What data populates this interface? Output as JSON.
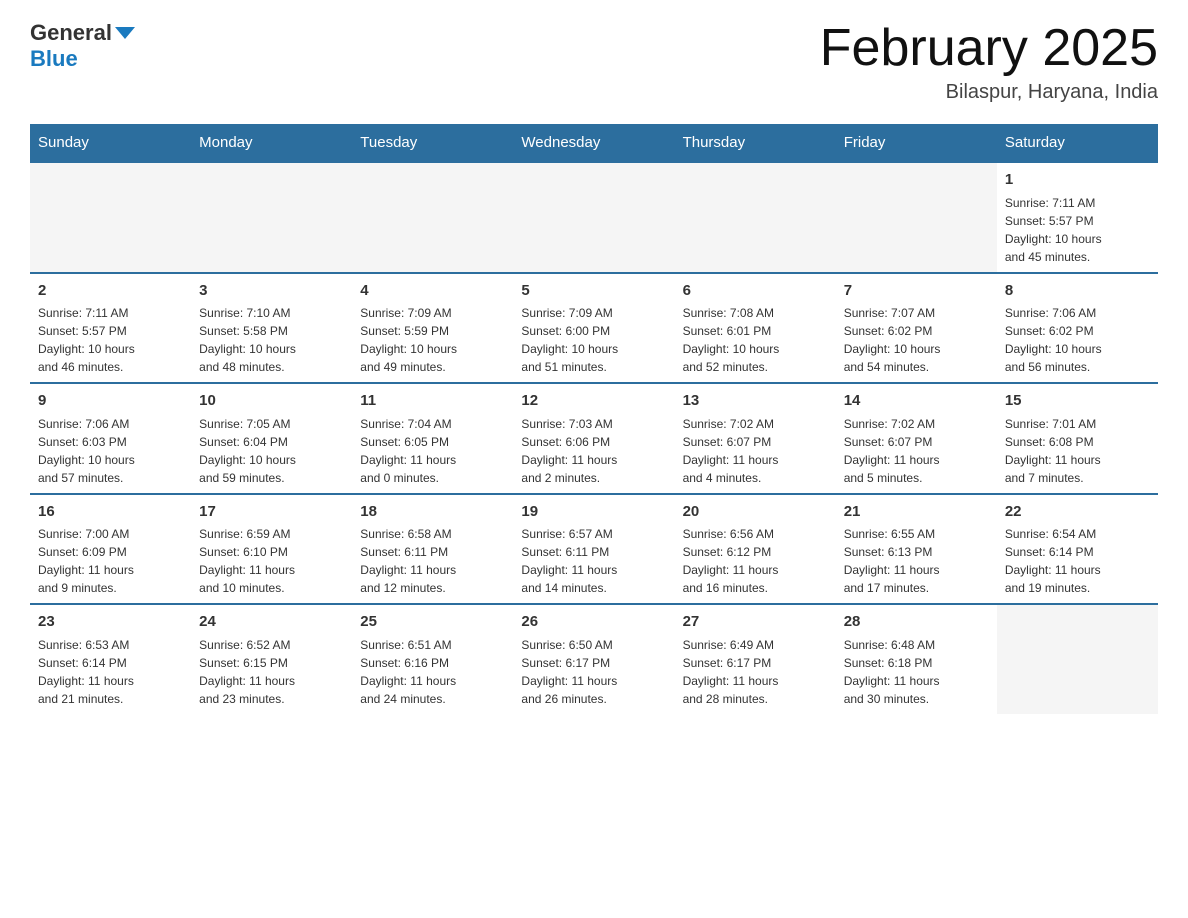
{
  "header": {
    "logo_general": "General",
    "logo_blue": "Blue",
    "title": "February 2025",
    "subtitle": "Bilaspur, Haryana, India"
  },
  "weekdays": [
    "Sunday",
    "Monday",
    "Tuesday",
    "Wednesday",
    "Thursday",
    "Friday",
    "Saturday"
  ],
  "weeks": [
    [
      {
        "day": "",
        "info": ""
      },
      {
        "day": "",
        "info": ""
      },
      {
        "day": "",
        "info": ""
      },
      {
        "day": "",
        "info": ""
      },
      {
        "day": "",
        "info": ""
      },
      {
        "day": "",
        "info": ""
      },
      {
        "day": "1",
        "info": "Sunrise: 7:11 AM\nSunset: 5:57 PM\nDaylight: 10 hours\nand 45 minutes."
      }
    ],
    [
      {
        "day": "2",
        "info": "Sunrise: 7:11 AM\nSunset: 5:57 PM\nDaylight: 10 hours\nand 46 minutes."
      },
      {
        "day": "3",
        "info": "Sunrise: 7:10 AM\nSunset: 5:58 PM\nDaylight: 10 hours\nand 48 minutes."
      },
      {
        "day": "4",
        "info": "Sunrise: 7:09 AM\nSunset: 5:59 PM\nDaylight: 10 hours\nand 49 minutes."
      },
      {
        "day": "5",
        "info": "Sunrise: 7:09 AM\nSunset: 6:00 PM\nDaylight: 10 hours\nand 51 minutes."
      },
      {
        "day": "6",
        "info": "Sunrise: 7:08 AM\nSunset: 6:01 PM\nDaylight: 10 hours\nand 52 minutes."
      },
      {
        "day": "7",
        "info": "Sunrise: 7:07 AM\nSunset: 6:02 PM\nDaylight: 10 hours\nand 54 minutes."
      },
      {
        "day": "8",
        "info": "Sunrise: 7:06 AM\nSunset: 6:02 PM\nDaylight: 10 hours\nand 56 minutes."
      }
    ],
    [
      {
        "day": "9",
        "info": "Sunrise: 7:06 AM\nSunset: 6:03 PM\nDaylight: 10 hours\nand 57 minutes."
      },
      {
        "day": "10",
        "info": "Sunrise: 7:05 AM\nSunset: 6:04 PM\nDaylight: 10 hours\nand 59 minutes."
      },
      {
        "day": "11",
        "info": "Sunrise: 7:04 AM\nSunset: 6:05 PM\nDaylight: 11 hours\nand 0 minutes."
      },
      {
        "day": "12",
        "info": "Sunrise: 7:03 AM\nSunset: 6:06 PM\nDaylight: 11 hours\nand 2 minutes."
      },
      {
        "day": "13",
        "info": "Sunrise: 7:02 AM\nSunset: 6:07 PM\nDaylight: 11 hours\nand 4 minutes."
      },
      {
        "day": "14",
        "info": "Sunrise: 7:02 AM\nSunset: 6:07 PM\nDaylight: 11 hours\nand 5 minutes."
      },
      {
        "day": "15",
        "info": "Sunrise: 7:01 AM\nSunset: 6:08 PM\nDaylight: 11 hours\nand 7 minutes."
      }
    ],
    [
      {
        "day": "16",
        "info": "Sunrise: 7:00 AM\nSunset: 6:09 PM\nDaylight: 11 hours\nand 9 minutes."
      },
      {
        "day": "17",
        "info": "Sunrise: 6:59 AM\nSunset: 6:10 PM\nDaylight: 11 hours\nand 10 minutes."
      },
      {
        "day": "18",
        "info": "Sunrise: 6:58 AM\nSunset: 6:11 PM\nDaylight: 11 hours\nand 12 minutes."
      },
      {
        "day": "19",
        "info": "Sunrise: 6:57 AM\nSunset: 6:11 PM\nDaylight: 11 hours\nand 14 minutes."
      },
      {
        "day": "20",
        "info": "Sunrise: 6:56 AM\nSunset: 6:12 PM\nDaylight: 11 hours\nand 16 minutes."
      },
      {
        "day": "21",
        "info": "Sunrise: 6:55 AM\nSunset: 6:13 PM\nDaylight: 11 hours\nand 17 minutes."
      },
      {
        "day": "22",
        "info": "Sunrise: 6:54 AM\nSunset: 6:14 PM\nDaylight: 11 hours\nand 19 minutes."
      }
    ],
    [
      {
        "day": "23",
        "info": "Sunrise: 6:53 AM\nSunset: 6:14 PM\nDaylight: 11 hours\nand 21 minutes."
      },
      {
        "day": "24",
        "info": "Sunrise: 6:52 AM\nSunset: 6:15 PM\nDaylight: 11 hours\nand 23 minutes."
      },
      {
        "day": "25",
        "info": "Sunrise: 6:51 AM\nSunset: 6:16 PM\nDaylight: 11 hours\nand 24 minutes."
      },
      {
        "day": "26",
        "info": "Sunrise: 6:50 AM\nSunset: 6:17 PM\nDaylight: 11 hours\nand 26 minutes."
      },
      {
        "day": "27",
        "info": "Sunrise: 6:49 AM\nSunset: 6:17 PM\nDaylight: 11 hours\nand 28 minutes."
      },
      {
        "day": "28",
        "info": "Sunrise: 6:48 AM\nSunset: 6:18 PM\nDaylight: 11 hours\nand 30 minutes."
      },
      {
        "day": "",
        "info": ""
      }
    ]
  ]
}
